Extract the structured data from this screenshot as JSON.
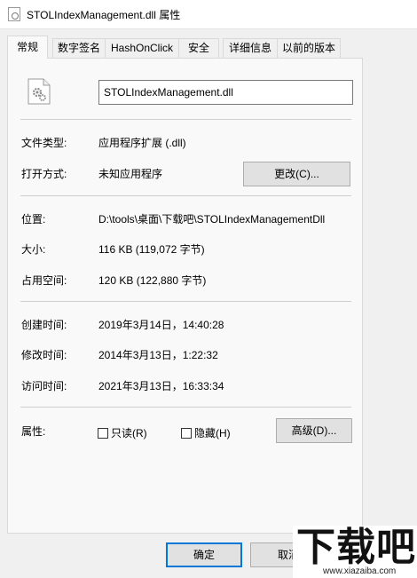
{
  "window": {
    "title": "STOLIndexManagement.dll 属性"
  },
  "tabs": [
    {
      "label": "常规",
      "active": true
    },
    {
      "label": "数字签名",
      "active": false
    },
    {
      "label": "HashOnClick",
      "active": false
    },
    {
      "label": "安全",
      "active": false
    },
    {
      "label": "详细信息",
      "active": false
    },
    {
      "label": "以前的版本",
      "active": false
    }
  ],
  "general": {
    "file_name": "STOLIndexManagement.dll",
    "file_type_label": "文件类型:",
    "file_type_value": "应用程序扩展 (.dll)",
    "opens_with_label": "打开方式:",
    "opens_with_value": "未知应用程序",
    "change_button": "更改(C)...",
    "location_label": "位置:",
    "location_value": "D:\\tools\\桌面\\下载吧\\STOLIndexManagementDll",
    "size_label": "大小:",
    "size_value": "116 KB (119,072 字节)",
    "size_on_disk_label": "占用空间:",
    "size_on_disk_value": "120 KB (122,880 字节)",
    "created_label": "创建时间:",
    "created_value": "2019年3月14日，14:40:28",
    "modified_label": "修改时间:",
    "modified_value": "2014年3月13日，1:22:32",
    "accessed_label": "访问时间:",
    "accessed_value": "2021年3月13日，16:33:34",
    "attributes_label": "属性:",
    "readonly_label": "只读(R)",
    "readonly_checked": false,
    "hidden_label": "隐藏(H)",
    "hidden_checked": false,
    "advanced_button": "高级(D)..."
  },
  "footer": {
    "ok_button": "确定",
    "cancel_button": "取消"
  },
  "watermark": {
    "main": "下载吧",
    "sub": "www.xiazaiba.com"
  }
}
